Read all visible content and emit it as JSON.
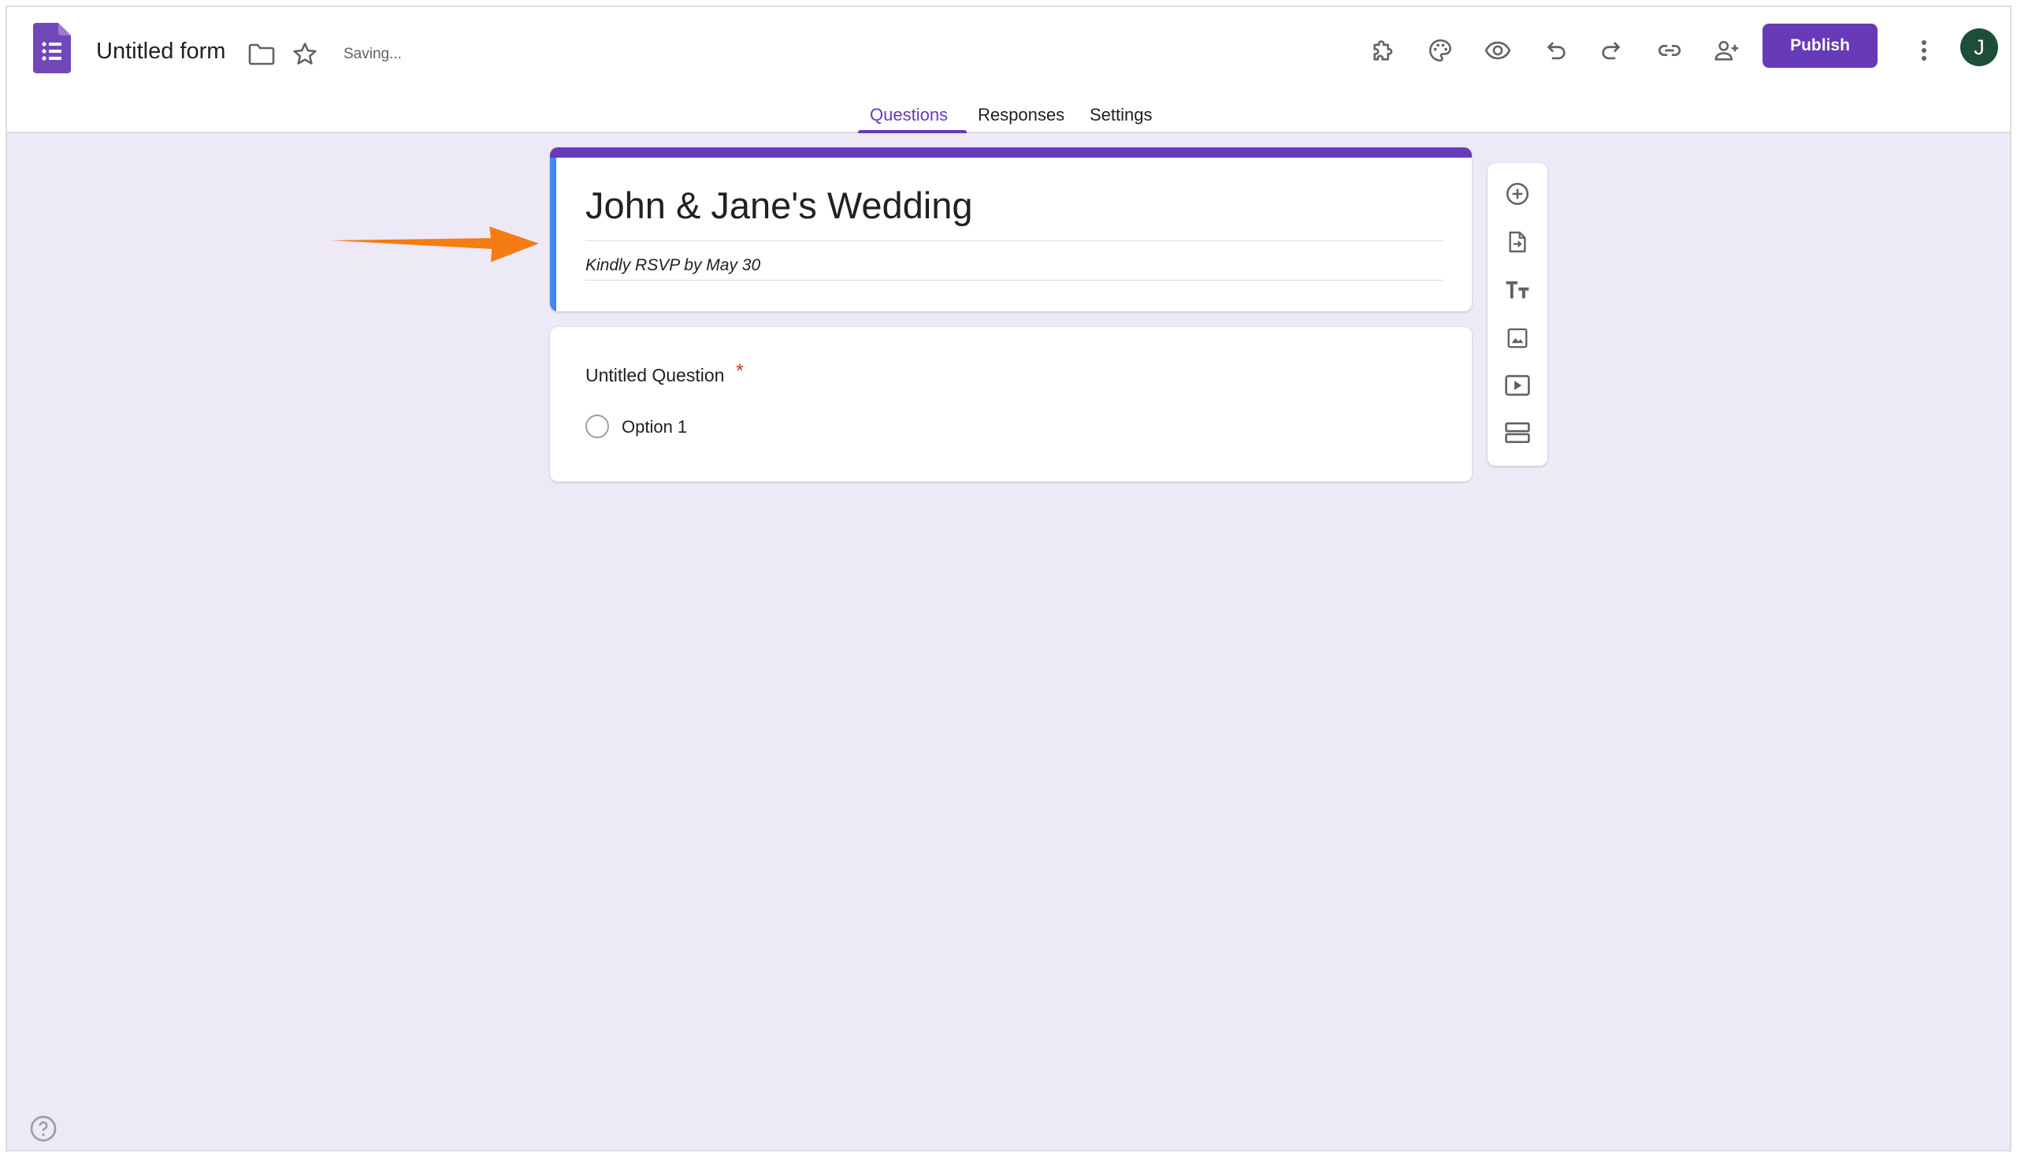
{
  "app": {
    "doc_title": "Untitled form",
    "save_status": "Saving...",
    "publish_label": "Publish",
    "avatar_initial": "J",
    "accent_color": "#673ab7"
  },
  "tabs": [
    {
      "label": "Questions",
      "active": true
    },
    {
      "label": "Responses",
      "active": false
    },
    {
      "label": "Settings",
      "active": false
    }
  ],
  "toolbar_icons": [
    "addons-icon",
    "palette-icon",
    "preview-eye-icon",
    "undo-icon",
    "redo-icon",
    "link-icon",
    "add-collaborator-icon",
    "more-vert-icon"
  ],
  "form": {
    "title": "John & Jane's Wedding",
    "description": "Kindly RSVP by May 30"
  },
  "question": {
    "title": "Untitled Question",
    "required_mark": "*",
    "options": [
      "Option 1"
    ]
  },
  "side_tools": [
    "add-question-icon",
    "import-questions-icon",
    "add-title-icon",
    "add-image-icon",
    "add-video-icon",
    "add-section-icon"
  ]
}
